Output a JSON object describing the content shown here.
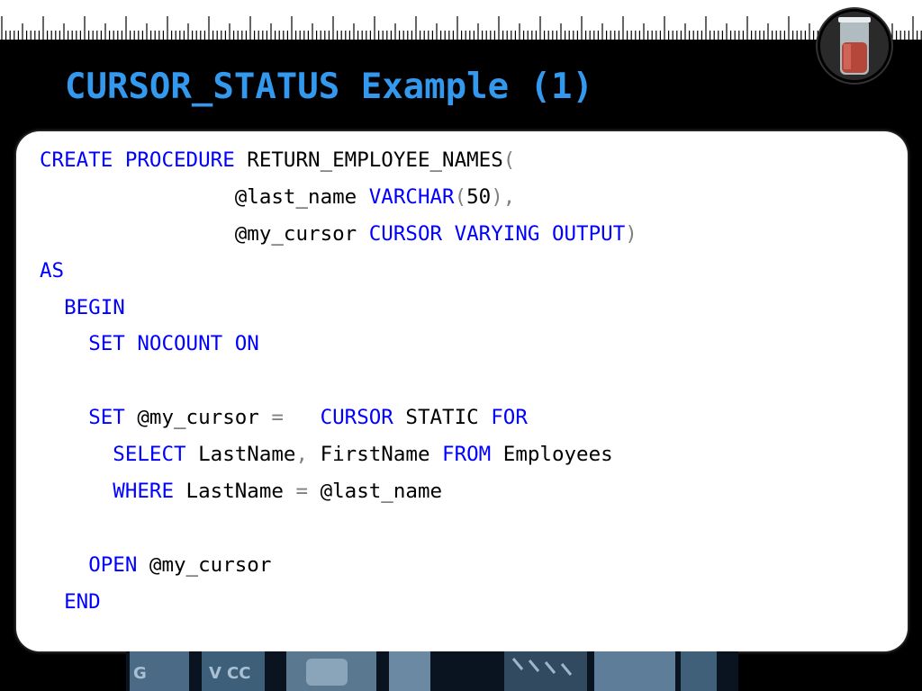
{
  "slide": {
    "title": "CURSOR_STATUS Example (1)"
  },
  "code": {
    "lines": [
      {
        "indent": 0,
        "tokens": [
          [
            "kw",
            "CREATE"
          ],
          [
            "t",
            " "
          ],
          [
            "kw",
            "PROCEDURE"
          ],
          [
            "t",
            " RETURN_EMPLOYEE_NAMES"
          ],
          [
            "op",
            "("
          ]
        ]
      },
      {
        "indent": 16,
        "tokens": [
          [
            "t",
            "@last_name "
          ],
          [
            "kw",
            "VARCHAR"
          ],
          [
            "op",
            "("
          ],
          [
            "t",
            "50"
          ],
          [
            "op",
            "),"
          ]
        ]
      },
      {
        "indent": 16,
        "tokens": [
          [
            "t",
            "@my_cursor "
          ],
          [
            "kw",
            "CURSOR"
          ],
          [
            "t",
            " "
          ],
          [
            "kw",
            "VARYING"
          ],
          [
            "t",
            " "
          ],
          [
            "kw",
            "OUTPUT"
          ],
          [
            "op",
            ")"
          ]
        ]
      },
      {
        "indent": 0,
        "tokens": [
          [
            "kw",
            "AS"
          ]
        ]
      },
      {
        "indent": 2,
        "tokens": [
          [
            "kw",
            "BEGIN"
          ]
        ]
      },
      {
        "indent": 4,
        "tokens": [
          [
            "kw",
            "SET"
          ],
          [
            "t",
            " "
          ],
          [
            "kw",
            "NOCOUNT"
          ],
          [
            "t",
            " "
          ],
          [
            "kw",
            "ON"
          ]
        ]
      },
      {
        "indent": 0,
        "tokens": []
      },
      {
        "indent": 4,
        "tokens": [
          [
            "kw",
            "SET"
          ],
          [
            "t",
            " @my_cursor "
          ],
          [
            "op",
            "="
          ],
          [
            "t",
            "   "
          ],
          [
            "kw",
            "CURSOR"
          ],
          [
            "t",
            " STATIC "
          ],
          [
            "kw",
            "FOR"
          ]
        ]
      },
      {
        "indent": 6,
        "tokens": [
          [
            "kw",
            "SELECT"
          ],
          [
            "t",
            " LastName"
          ],
          [
            "op",
            ","
          ],
          [
            "t",
            " FirstName "
          ],
          [
            "kw",
            "FROM"
          ],
          [
            "t",
            " Employees"
          ]
        ]
      },
      {
        "indent": 6,
        "tokens": [
          [
            "kw",
            "WHERE"
          ],
          [
            "t",
            " LastName "
          ],
          [
            "op",
            "="
          ],
          [
            "t",
            " @last_name"
          ]
        ]
      },
      {
        "indent": 0,
        "tokens": []
      },
      {
        "indent": 4,
        "tokens": [
          [
            "kw",
            "OPEN"
          ],
          [
            "t",
            " @my_cursor"
          ]
        ]
      },
      {
        "indent": 2,
        "tokens": [
          [
            "kw",
            "END"
          ]
        ]
      }
    ]
  },
  "colors": {
    "title": "#3399ee",
    "keyword": "#0000ff",
    "operator": "#808080",
    "background": "#000000",
    "panel": "#ffffff"
  },
  "icons": {
    "top_right": "lab-beaker-icon",
    "bottom_strip": "decorative-photo-strip"
  }
}
